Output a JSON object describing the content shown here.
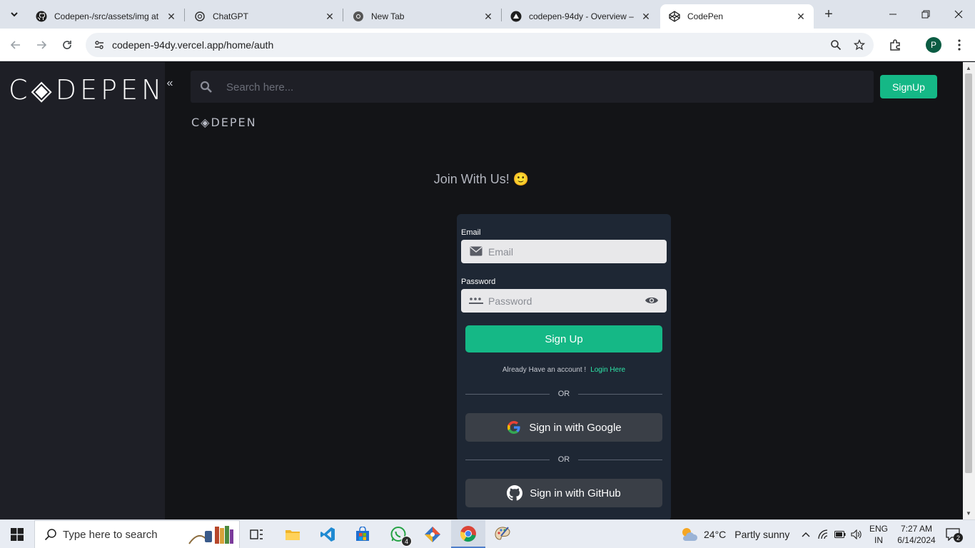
{
  "browser": {
    "tab_list_icon": "chevron-down-icon",
    "tabs": [
      {
        "title": "Codepen-/src/assets/img at",
        "icon": "github-icon"
      },
      {
        "title": "ChatGPT",
        "icon": "chatgpt-icon"
      },
      {
        "title": "New Tab",
        "icon": "chrome-icon"
      },
      {
        "title": "codepen-94dy - Overview –",
        "icon": "vercel-icon"
      },
      {
        "title": "CodePen",
        "icon": "codepen-icon",
        "active": true
      }
    ],
    "new_tab_icon": "plus-icon",
    "url": "codepen-94dy.vercel.app/home/auth",
    "profile_initial": "P"
  },
  "page": {
    "brand": "C◈DEPEN",
    "brand_small": "C◈DEPEN",
    "search": {
      "placeholder": "Search here..."
    },
    "signup_top_label": "SignUp",
    "join_title": "Join With Us! 🙂",
    "form": {
      "email_label": "Email",
      "email_placeholder": "Email",
      "password_label": "Password",
      "password_placeholder": "Password",
      "signup_label": "Sign Up",
      "already_text": "Already Have an account !",
      "login_link": "Login Here",
      "or_text": "OR",
      "google_label": "Sign in with Google",
      "github_label": "Sign in with GitHub"
    }
  },
  "taskbar": {
    "search_placeholder": "Type here to search",
    "whatsapp_badge": "4",
    "weather_temp": "24°C",
    "weather_condition": "Partly sunny",
    "lang_line1": "ENG",
    "lang_line2": "IN",
    "time": "7:27 AM",
    "date": "6/14/2024",
    "notification_count": "2"
  },
  "colors": {
    "accent": "#15b886",
    "page_bg": "#131417",
    "sidebar_bg": "#1e1f26",
    "card_bg": "#1e2734",
    "link": "#2ee6a8"
  }
}
